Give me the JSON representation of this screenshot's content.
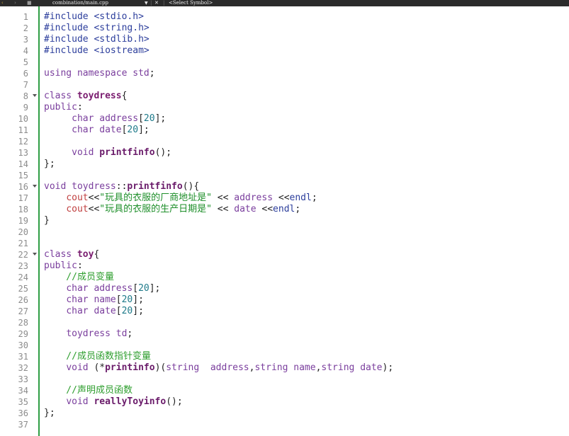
{
  "topbar": {
    "file": "combination/main.cpp",
    "symbol": "<Select Symbol>"
  },
  "lines": [
    {
      "n": "1",
      "code": "#include <stdio.h>"
    },
    {
      "n": "2",
      "code": "#include <string.h>"
    },
    {
      "n": "3",
      "code": "#include <stdlib.h>"
    },
    {
      "n": "4",
      "code": "#include <iostream>"
    },
    {
      "n": "5",
      "code": ""
    },
    {
      "n": "6",
      "code": "using namespace std;"
    },
    {
      "n": "7",
      "code": ""
    },
    {
      "n": "8",
      "code": "class toydress{",
      "fold": true
    },
    {
      "n": "9",
      "code": "public:"
    },
    {
      "n": "10",
      "code": "     char address[20];"
    },
    {
      "n": "11",
      "code": "     char date[20];"
    },
    {
      "n": "12",
      "code": ""
    },
    {
      "n": "13",
      "code": "     void printfinfo();"
    },
    {
      "n": "14",
      "code": "};"
    },
    {
      "n": "15",
      "code": ""
    },
    {
      "n": "16",
      "code": "void toydress::printfinfo(){",
      "fold": true
    },
    {
      "n": "17",
      "code": "    cout<<\"玩具的衣服的厂商地址是\" << address <<endl;"
    },
    {
      "n": "18",
      "code": "    cout<<\"玩具的衣服的生产日期是\" << date <<endl;"
    },
    {
      "n": "19",
      "code": "}"
    },
    {
      "n": "20",
      "code": ""
    },
    {
      "n": "21",
      "code": ""
    },
    {
      "n": "22",
      "code": "class toy{",
      "fold": true
    },
    {
      "n": "23",
      "code": "public:"
    },
    {
      "n": "24",
      "code": "    //成员变量"
    },
    {
      "n": "25",
      "code": "    char address[20];"
    },
    {
      "n": "26",
      "code": "    char name[20];"
    },
    {
      "n": "27",
      "code": "    char date[20];"
    },
    {
      "n": "28",
      "code": ""
    },
    {
      "n": "29",
      "code": "    toydress td;"
    },
    {
      "n": "30",
      "code": ""
    },
    {
      "n": "31",
      "code": "    //成员函数指针变量"
    },
    {
      "n": "32",
      "code": "    void (*printinfo)(string  address,string name,string date);"
    },
    {
      "n": "33",
      "code": ""
    },
    {
      "n": "34",
      "code": "    //声明成员函数"
    },
    {
      "n": "35",
      "code": "    void reallyToyinfo();"
    },
    {
      "n": "36",
      "code": "};"
    },
    {
      "n": "37",
      "code": ""
    }
  ]
}
